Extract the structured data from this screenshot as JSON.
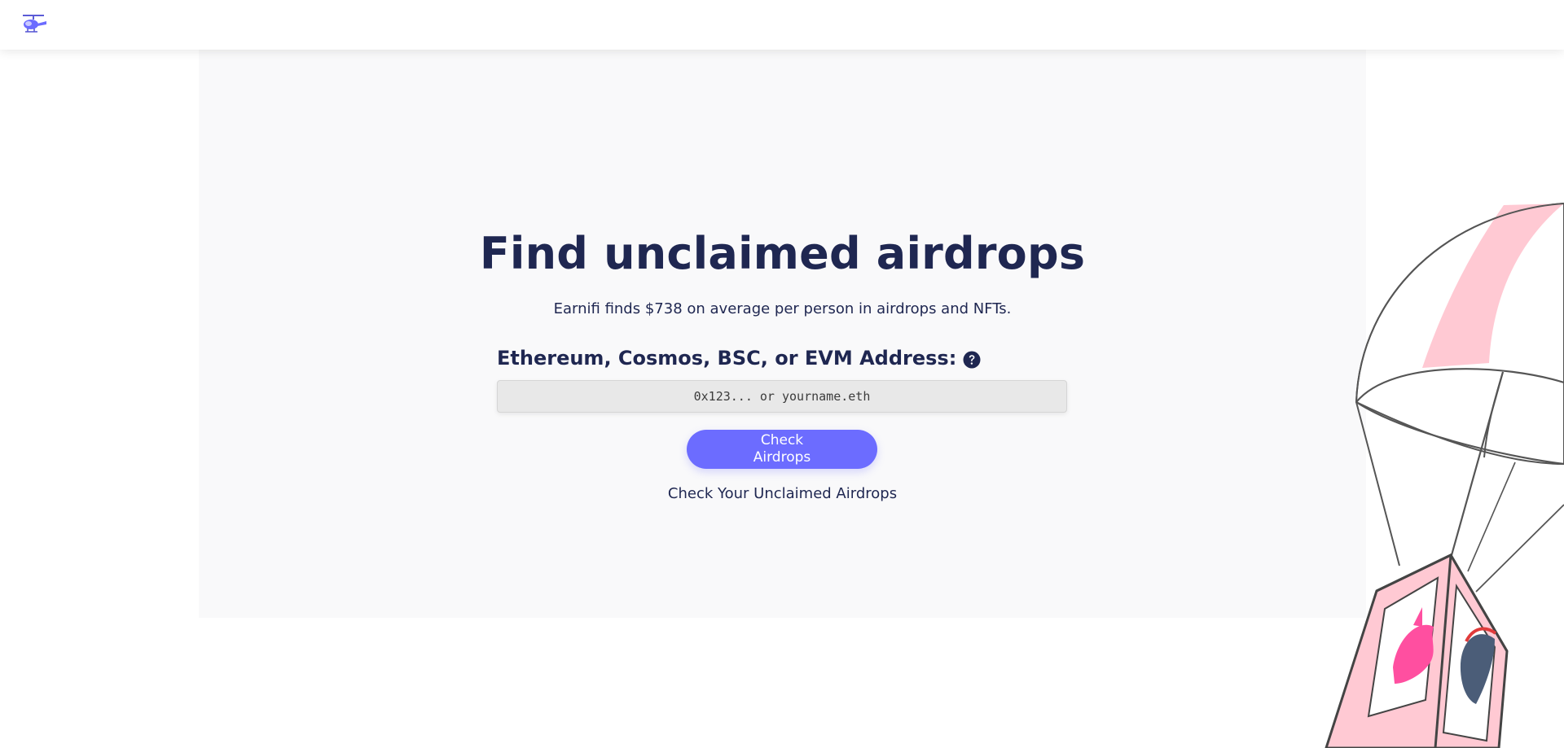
{
  "header": {
    "logo_icon": "helicopter-icon"
  },
  "hero": {
    "title": "Find unclaimed airdrops",
    "subtitle": "Earnifi finds $738 on average per person in airdrops and NFTs."
  },
  "form": {
    "label": "Ethereum, Cosmos, BSC, or EVM Address:",
    "help_icon": "question-circle-icon",
    "input_value": "",
    "input_placeholder": "0x123... or yourname.eth",
    "button_label": "Check Airdrops",
    "link_text": "Check Your Unclaimed Airdrops"
  },
  "colors": {
    "accent": "#6c6cff",
    "text": "#1f2751",
    "panel": "#f9f9fa",
    "parachute_pink": "#ffc9d3"
  },
  "illustration": {
    "type": "parachute-crate",
    "icons": [
      "unicorn-icon",
      "horse-icon"
    ]
  }
}
